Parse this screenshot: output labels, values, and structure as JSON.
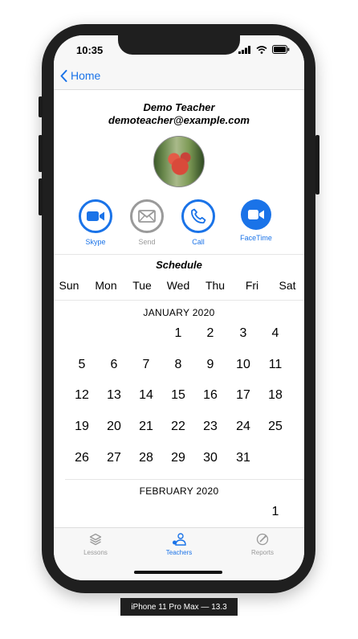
{
  "status": {
    "time": "10:35"
  },
  "nav": {
    "back_label": "Home"
  },
  "teacher": {
    "name": "Demo Teacher",
    "email": "demoteacher@example.com"
  },
  "actions": [
    {
      "label": "Skype",
      "icon": "video-camera-icon",
      "color": "#1a73e8"
    },
    {
      "label": "Send",
      "icon": "envelope-icon",
      "color": "#9a9a9a"
    },
    {
      "label": "Call",
      "icon": "phone-icon",
      "color": "#1a73e8"
    },
    {
      "label": "FaceTime",
      "icon": "video-camera-icon",
      "color": "#1a73e8"
    }
  ],
  "schedule": {
    "title": "Schedule",
    "weekdays": [
      "Sun",
      "Mon",
      "Tue",
      "Wed",
      "Thu",
      "Fri",
      "Sat"
    ],
    "months": [
      {
        "label": "JANUARY 2020"
      },
      {
        "label": "FEBRUARY 2020"
      }
    ]
  },
  "tabs": [
    {
      "label": "Lessons",
      "icon": "layers-icon",
      "active": false
    },
    {
      "label": "Teachers",
      "icon": "teachers-icon",
      "active": true
    },
    {
      "label": "Reports",
      "icon": "reports-icon",
      "active": false
    }
  ],
  "caption": "iPhone 11 Pro Max — 13.3"
}
